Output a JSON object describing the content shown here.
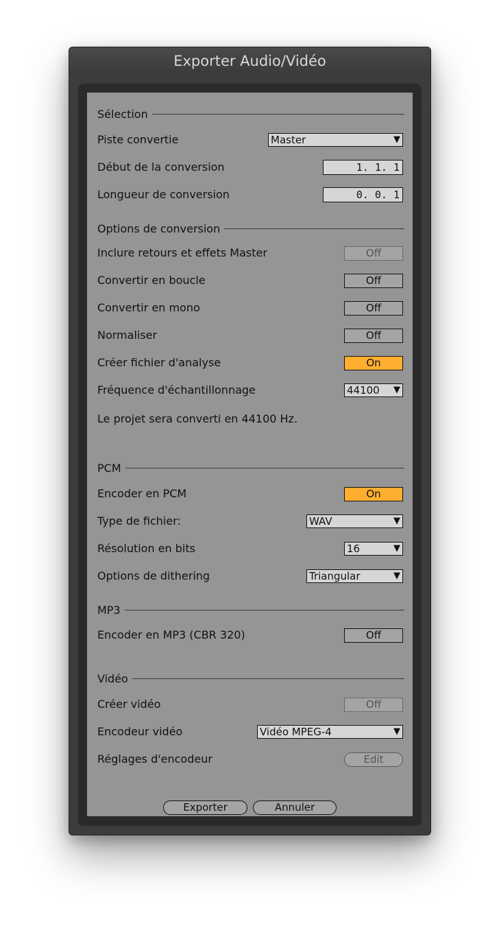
{
  "window": {
    "title": "Exporter Audio/Vidéo"
  },
  "selection": {
    "header": "Sélection",
    "track_label": "Piste convertie",
    "track_value": "Master",
    "start_label": "Début de la conversion",
    "start_value": "1. 1. 1",
    "length_label": "Longueur de conversion",
    "length_value": "0. 0. 1"
  },
  "options": {
    "header": "Options de conversion",
    "include_returns_label": "Inclure retours et effets Master",
    "include_returns_value": "Off",
    "loop_label": "Convertir en boucle",
    "loop_value": "Off",
    "mono_label": "Convertir en mono",
    "mono_value": "Off",
    "normalize_label": "Normaliser",
    "normalize_value": "Off",
    "analysis_label": "Créer fichier d'analyse",
    "analysis_value": "On",
    "sample_rate_label": "Fréquence d'échantillonnage",
    "sample_rate_value": "44100",
    "info": "Le projet sera converti en 44100 Hz."
  },
  "pcm": {
    "header": "PCM",
    "encode_label": "Encoder en PCM",
    "encode_value": "On",
    "file_type_label": "Type de fichier:",
    "file_type_value": "WAV",
    "bit_depth_label": "Résolution en bits",
    "bit_depth_value": "16",
    "dither_label": "Options de dithering",
    "dither_value": "Triangular"
  },
  "mp3": {
    "header": "MP3",
    "encode_label": "Encoder en MP3 (CBR 320)",
    "encode_value": "Off"
  },
  "video": {
    "header": "Vidéo",
    "create_label": "Créer vidéo",
    "create_value": "Off",
    "encoder_label": "Encodeur vidéo",
    "encoder_value": "Vidéo MPEG-4",
    "settings_label": "Réglages d'encodeur",
    "settings_button": "Edit"
  },
  "footer": {
    "export_button": "Exporter",
    "cancel_button": "Annuler"
  },
  "colors": {
    "accent_on": "#ffaf30",
    "panel": "#959595",
    "frame": "#2a2a2a"
  },
  "icons": {
    "dropdown_arrow": "▼"
  }
}
